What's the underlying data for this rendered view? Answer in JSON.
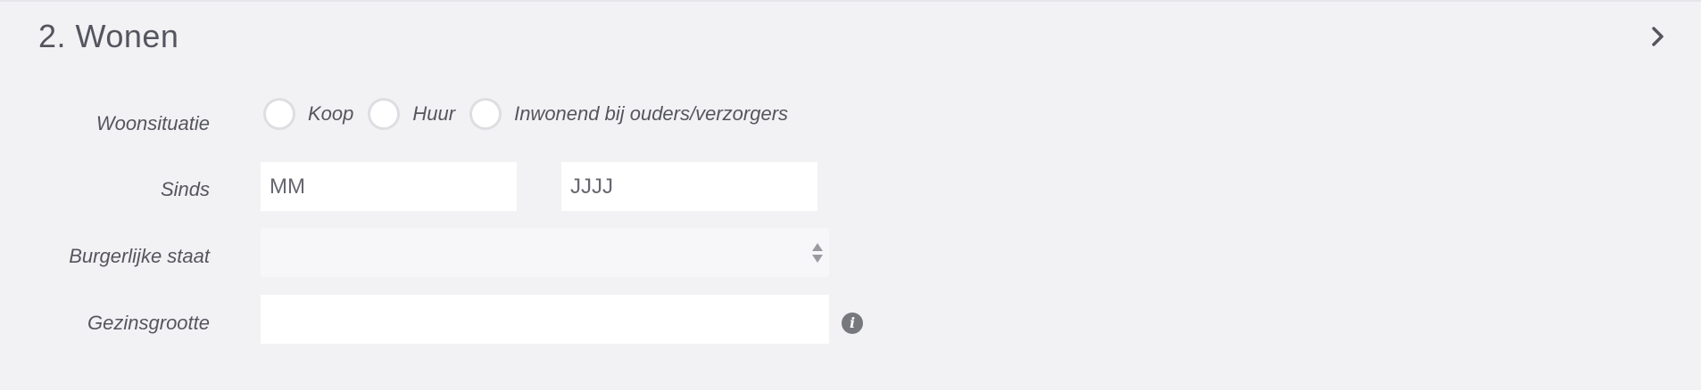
{
  "section": {
    "title": "2. Wonen"
  },
  "icons": {
    "chevron": "chevron-right-icon",
    "select_arrows": "sort-arrows-icon",
    "info": "info-icon"
  },
  "form": {
    "woonsituatie": {
      "label": "Woonsituatie",
      "options": [
        "Koop",
        "Huur",
        "Inwonend bij ouders/verzorgers"
      ]
    },
    "sinds": {
      "label": "Sinds",
      "month_placeholder": "MM",
      "year_placeholder": "JJJJ"
    },
    "burgerlijke_staat": {
      "label": "Burgerlijke staat",
      "value": ""
    },
    "gezinsgrootte": {
      "label": "Gezinsgrootte",
      "value": "",
      "info_glyph": "i"
    }
  }
}
